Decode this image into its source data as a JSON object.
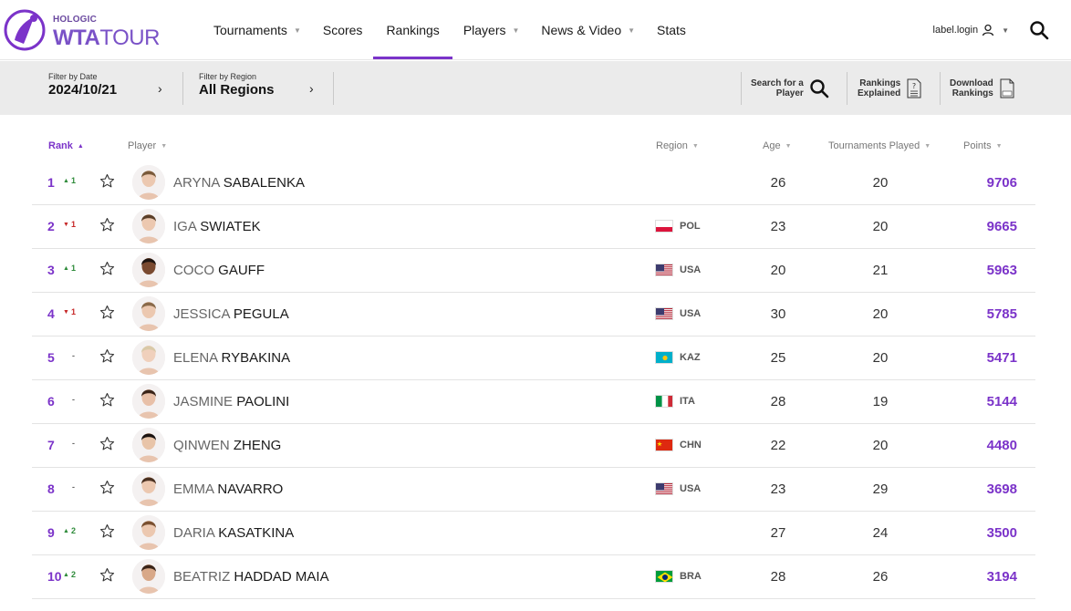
{
  "brand": {
    "top": "HOLOGIC",
    "wta": "WTA",
    "tour": "TOUR",
    "accent": "#7b33c9"
  },
  "nav": {
    "items": [
      {
        "label": "Tournaments",
        "dropdown": true,
        "active": false
      },
      {
        "label": "Scores",
        "dropdown": false,
        "active": false
      },
      {
        "label": "Rankings",
        "dropdown": false,
        "active": true
      },
      {
        "label": "Players",
        "dropdown": true,
        "active": false
      },
      {
        "label": "News & Video",
        "dropdown": true,
        "active": false
      },
      {
        "label": "Stats",
        "dropdown": false,
        "active": false
      }
    ],
    "login_label": "label.login"
  },
  "filters": {
    "date": {
      "label": "Filter by Date",
      "value": "2024/10/21"
    },
    "region": {
      "label": "Filter by Region",
      "value": "All Regions"
    }
  },
  "tools": {
    "search": {
      "line1": "Search for a",
      "line2": "Player"
    },
    "explained": {
      "line1": "Rankings",
      "line2": "Explained"
    },
    "download": {
      "line1": "Download",
      "line2": "Rankings"
    }
  },
  "table": {
    "headers": {
      "rank": "Rank",
      "player": "Player",
      "region": "Region",
      "age": "Age",
      "played": "Tournaments Played",
      "points": "Points"
    },
    "rows": [
      {
        "rank": "1",
        "move_dir": "up",
        "move": "1",
        "first": "ARYNA",
        "last": "SABALENKA",
        "country": "",
        "flag": "",
        "age": "26",
        "played": "20",
        "points": "9706"
      },
      {
        "rank": "2",
        "move_dir": "down",
        "move": "1",
        "first": "IGA",
        "last": "SWIATEK",
        "country": "POL",
        "flag": "pol",
        "age": "23",
        "played": "20",
        "points": "9665"
      },
      {
        "rank": "3",
        "move_dir": "up",
        "move": "1",
        "first": "COCO",
        "last": "GAUFF",
        "country": "USA",
        "flag": "usa",
        "age": "20",
        "played": "21",
        "points": "5963"
      },
      {
        "rank": "4",
        "move_dir": "down",
        "move": "1",
        "first": "JESSICA",
        "last": "PEGULA",
        "country": "USA",
        "flag": "usa",
        "age": "30",
        "played": "20",
        "points": "5785"
      },
      {
        "rank": "5",
        "move_dir": "same",
        "move": "-",
        "first": "ELENA",
        "last": "RYBAKINA",
        "country": "KAZ",
        "flag": "kaz",
        "age": "25",
        "played": "20",
        "points": "5471"
      },
      {
        "rank": "6",
        "move_dir": "same",
        "move": "-",
        "first": "JASMINE",
        "last": "PAOLINI",
        "country": "ITA",
        "flag": "ita",
        "age": "28",
        "played": "19",
        "points": "5144"
      },
      {
        "rank": "7",
        "move_dir": "same",
        "move": "-",
        "first": "QINWEN",
        "last": "ZHENG",
        "country": "CHN",
        "flag": "chn",
        "age": "22",
        "played": "20",
        "points": "4480"
      },
      {
        "rank": "8",
        "move_dir": "same",
        "move": "-",
        "first": "EMMA",
        "last": "NAVARRO",
        "country": "USA",
        "flag": "usa",
        "age": "23",
        "played": "29",
        "points": "3698"
      },
      {
        "rank": "9",
        "move_dir": "up",
        "move": "2",
        "first": "DARIA",
        "last": "KASATKINA",
        "country": "",
        "flag": "",
        "age": "27",
        "played": "24",
        "points": "3500"
      },
      {
        "rank": "10",
        "move_dir": "up",
        "move": "2",
        "first": "BEATRIZ",
        "last": "HADDAD MAIA",
        "country": "BRA",
        "flag": "bra",
        "age": "28",
        "played": "26",
        "points": "3194"
      }
    ]
  }
}
